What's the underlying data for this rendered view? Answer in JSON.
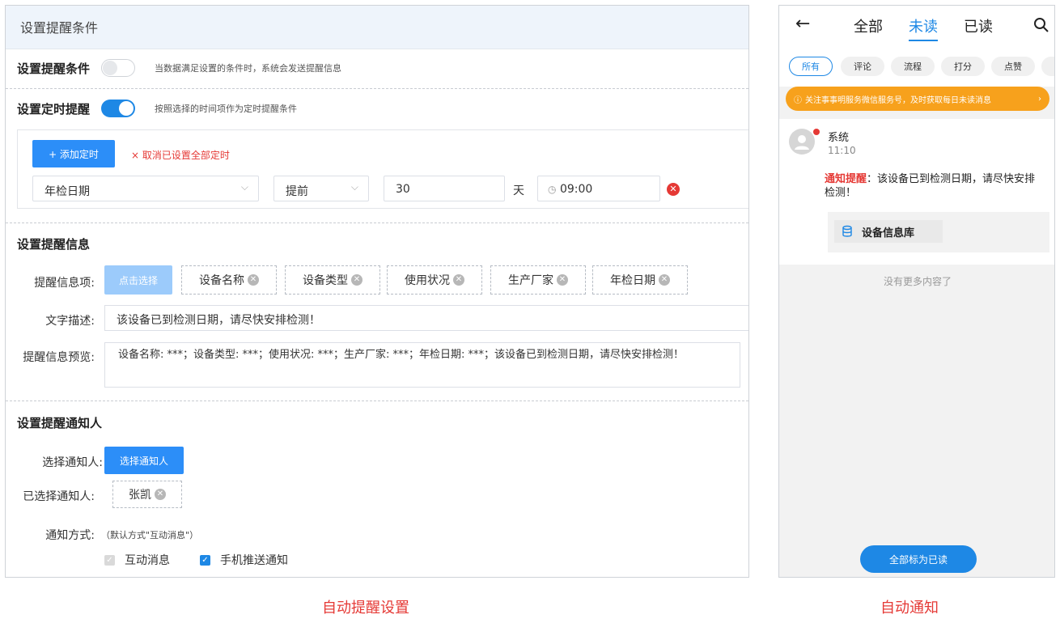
{
  "settings": {
    "header_title": "设置提醒条件",
    "condition": {
      "title": "设置提醒条件",
      "hint": "当数据满足设置的条件时，系统会发送提醒信息",
      "enabled": false
    },
    "timer": {
      "title": "设置定时提醒",
      "hint": "按照选择的时间项作为定时提醒条件",
      "enabled": true,
      "add_label": "+ 添加定时",
      "cancel_label": "× 取消已设置全部定时",
      "date_field": "年检日期",
      "direction": "提前",
      "amount": "30",
      "unit": "天",
      "time": "09:00"
    },
    "info": {
      "title": "设置提醒信息",
      "items_label": "提醒信息项:",
      "select_button": "点击选择",
      "tags": [
        "设备名称",
        "设备类型",
        "使用状况",
        "生产厂家",
        "年检日期"
      ],
      "text_label": "文字描述:",
      "text_value": "该设备已到检测日期，请尽快安排检测！",
      "preview_label": "提醒信息预览:",
      "preview_value": "设备名称: ***；设备类型: ***；使用状况: ***；生产厂家: ***；年检日期: ***；该设备已到检测日期，请尽快安排检测！"
    },
    "notify": {
      "title": "设置提醒通知人",
      "choose_label": "选择通知人:",
      "choose_button": "选择通知人",
      "chosen_label": "已选择通知人:",
      "chosen_person": "张凯",
      "method_label": "通知方式:",
      "method_hint": "（默认方式\"互动消息\"）",
      "methods": [
        {
          "label": "互动消息",
          "checked": true,
          "disabled": true
        },
        {
          "label": "手机推送通知",
          "checked": true,
          "disabled": false
        }
      ]
    }
  },
  "phone": {
    "tabs": [
      "全部",
      "未读",
      "已读"
    ],
    "active_tab": "未读",
    "chips": [
      "所有",
      "评论",
      "流程",
      "打分",
      "点赞"
    ],
    "banner": "关注事事明服务微信服务号，及时获取每日未读消息",
    "message": {
      "sender": "系统",
      "time": "11:10",
      "prefix": "通知提醒",
      "body": "：该设备已到检测日期，请尽快安排检测！",
      "attachment": "设备信息库"
    },
    "no_more": "没有更多内容了",
    "mark_all": "全部标为已读"
  },
  "captions": {
    "left": "自动提醒设置",
    "right": "自动通知"
  },
  "colors": {
    "accent": "#1e88e5",
    "danger": "#e53935",
    "banner": "#f7a11c"
  }
}
